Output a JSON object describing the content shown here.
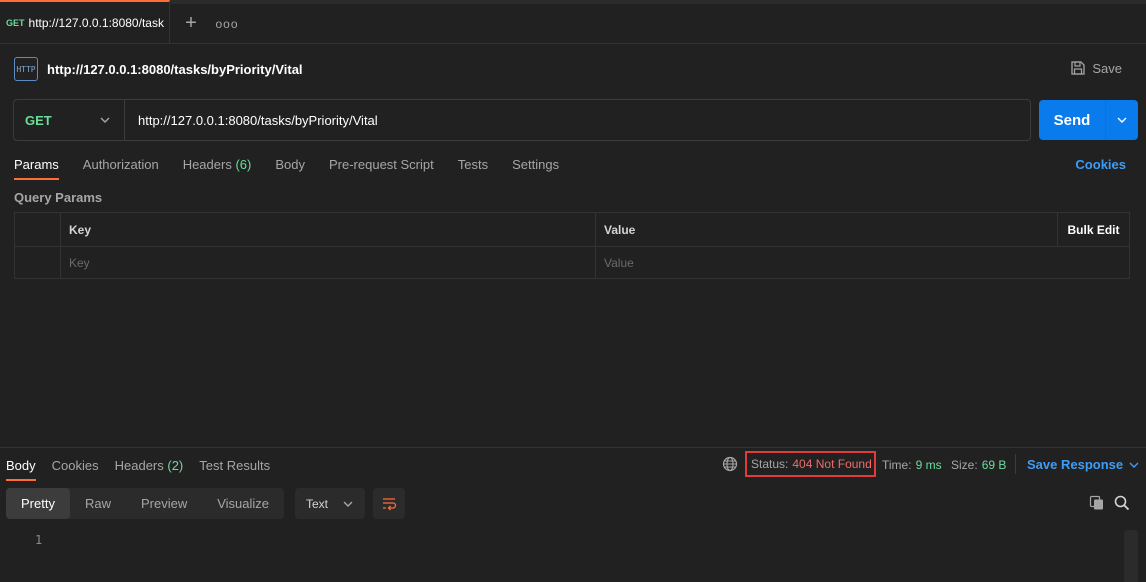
{
  "tab": {
    "method": "GET",
    "title": "http://127.0.0.1:8080/task"
  },
  "request": {
    "icon_label": "HTTP",
    "title": "http://127.0.0.1:8080/tasks/byPriority/Vital",
    "save_label": "Save",
    "method": "GET",
    "url": "http://127.0.0.1:8080/tasks/byPriority/Vital",
    "send_label": "Send"
  },
  "request_tabs": [
    {
      "label": "Params"
    },
    {
      "label": "Authorization"
    },
    {
      "label": "Headers",
      "count": "(6)"
    },
    {
      "label": "Body"
    },
    {
      "label": "Pre-request Script"
    },
    {
      "label": "Tests"
    },
    {
      "label": "Settings"
    }
  ],
  "cookies_label": "Cookies",
  "query_params": {
    "title": "Query Params",
    "headers": {
      "key": "Key",
      "value": "Value",
      "bulk_edit": "Bulk Edit"
    },
    "key_placeholder": "Key",
    "value_placeholder": "Value"
  },
  "response_tabs": [
    {
      "label": "Body"
    },
    {
      "label": "Cookies"
    },
    {
      "label": "Headers",
      "count": "(2)"
    },
    {
      "label": "Test Results"
    }
  ],
  "response_meta": {
    "status_label": "Status:",
    "status_code": "404",
    "status_text": "Not Found",
    "time_label": "Time:",
    "time_value": "9 ms",
    "size_label": "Size:",
    "size_value": "69 B",
    "save_response_label": "Save Response"
  },
  "view_modes": [
    "Pretty",
    "Raw",
    "Preview",
    "Visualize"
  ],
  "format": "Text",
  "line_number": "1",
  "colors": {
    "accent": "#ff6c37",
    "send": "#097bed",
    "get": "#6bdd9a",
    "error": "#f26b6b",
    "link": "#3e9cf6"
  },
  "icons": [
    "http-icon",
    "save-icon",
    "chevron-down-icon",
    "globe-icon",
    "wrap-icon",
    "copy-icon",
    "search-icon",
    "plus-icon",
    "more-icon"
  ]
}
